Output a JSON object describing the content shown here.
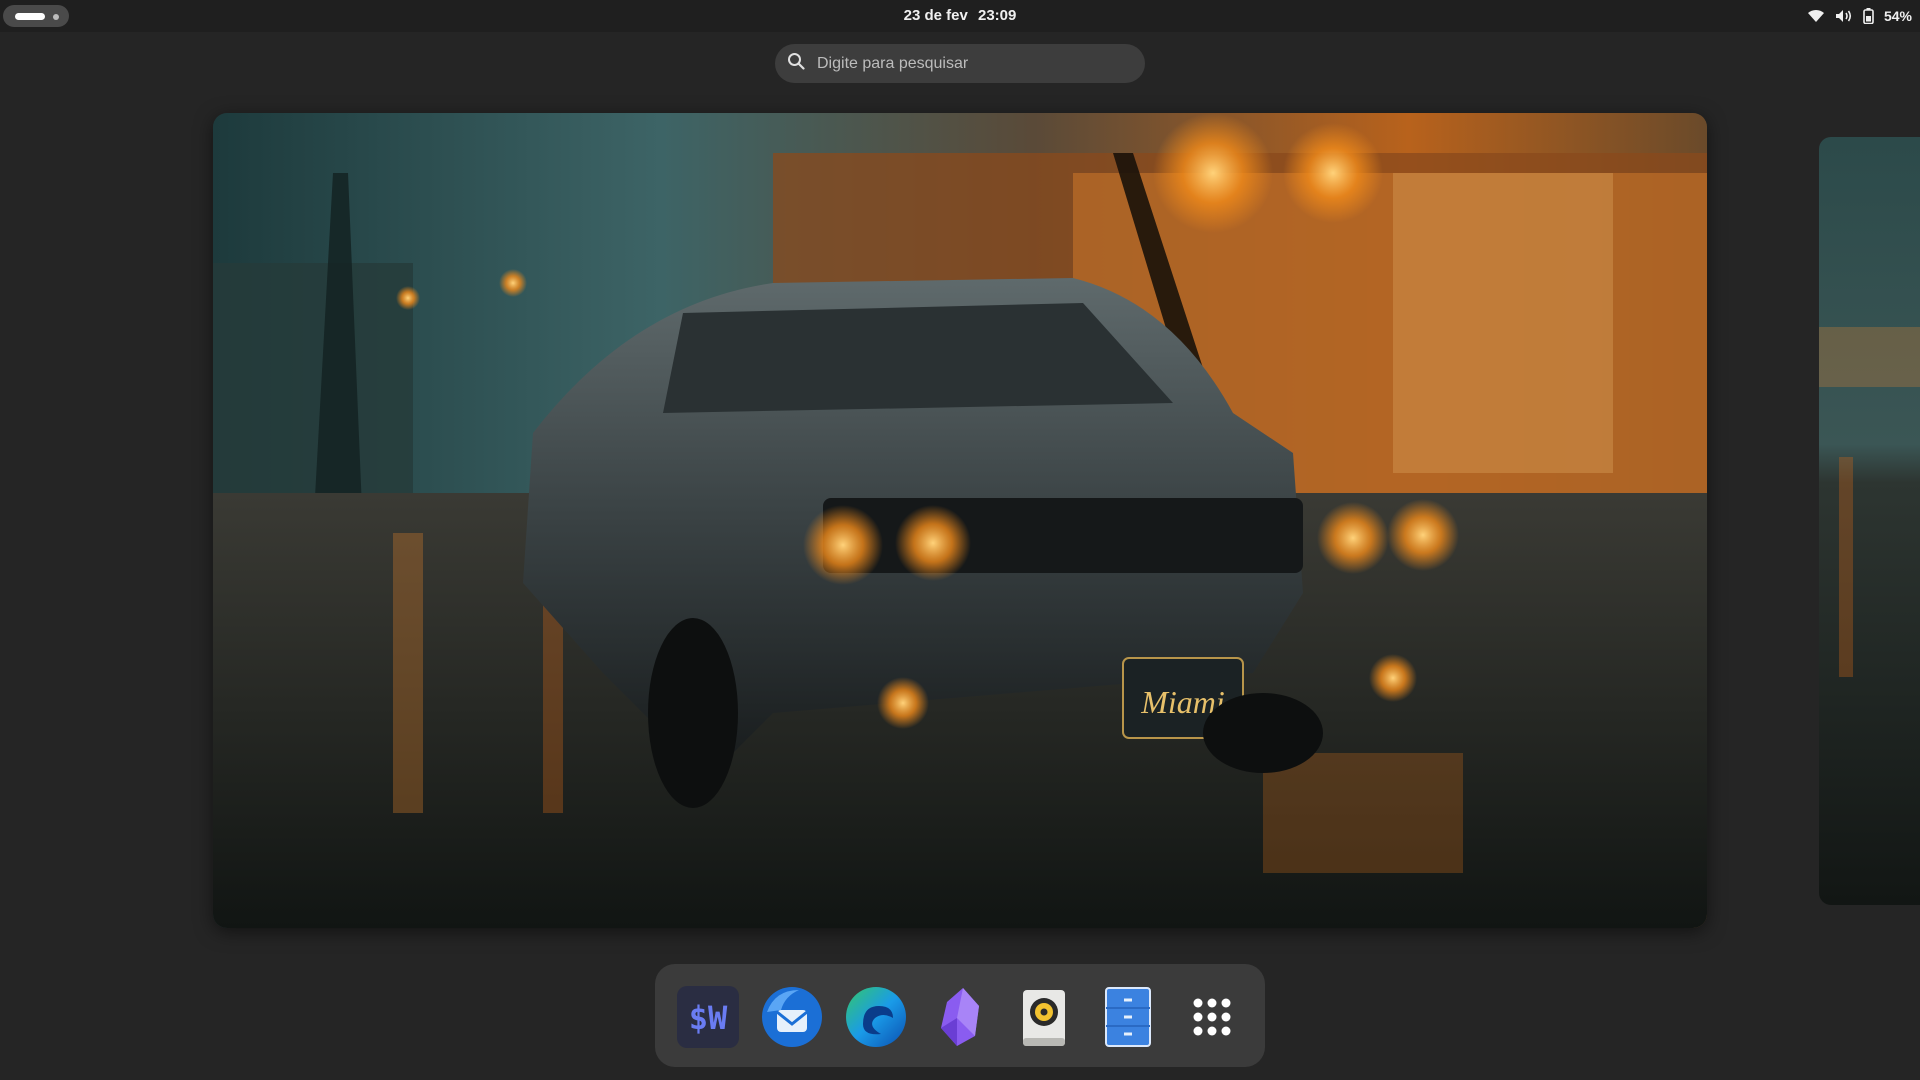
{
  "topbar": {
    "date": "23 de fev",
    "time": "23:09",
    "battery_percent": "54%",
    "icons": [
      "activities-indicator",
      "wifi-icon",
      "volume-icon",
      "battery-icon"
    ]
  },
  "search": {
    "placeholder": "Digite para pesquisar",
    "icon": "search-icon"
  },
  "windows": {
    "main": {
      "description_icon": "wallpaper-preview",
      "plate_text": "Miami"
    }
  },
  "dock": {
    "items": [
      {
        "name": "Warp",
        "icon": "warp-terminal-icon",
        "label": "$W"
      },
      {
        "name": "Thunderbird",
        "icon": "thunderbird-icon"
      },
      {
        "name": "Microsoft Edge",
        "icon": "edge-icon"
      },
      {
        "name": "Obsidian",
        "icon": "obsidian-icon"
      },
      {
        "name": "Rhythmbox",
        "icon": "speaker-icon"
      },
      {
        "name": "Files",
        "icon": "file-cabinet-icon"
      },
      {
        "name": "Show Apps",
        "icon": "app-grid-icon"
      }
    ]
  },
  "colors": {
    "background": "#252525",
    "topbar": "#1f1f1f",
    "dock": "#3b3b3b",
    "search": "#3d3d3d"
  }
}
